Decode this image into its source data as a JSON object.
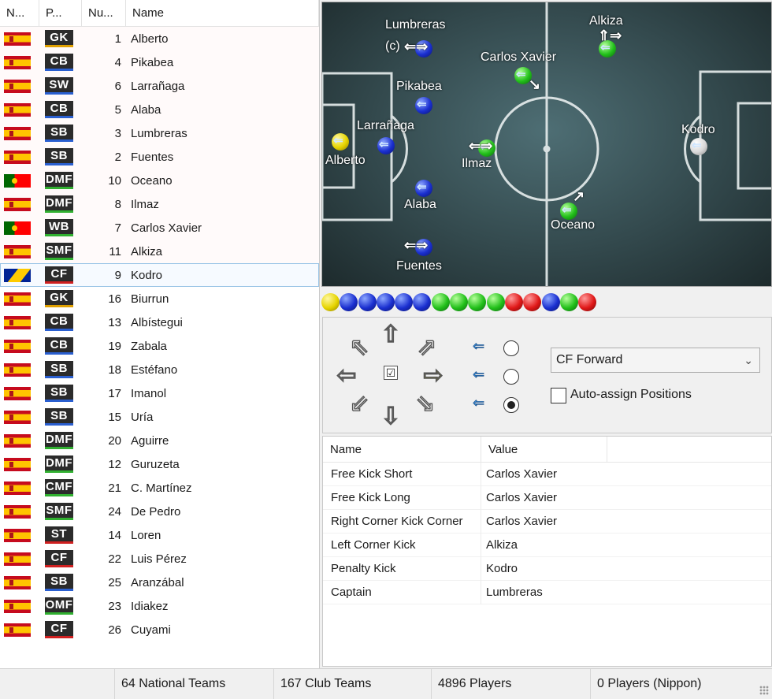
{
  "roster": {
    "headers": {
      "nat": "N...",
      "pos": "P...",
      "num": "Nu...",
      "name": "Name"
    },
    "players": [
      {
        "flag": "es",
        "pos": "GK",
        "cls": "gk",
        "num": "1",
        "name": "Alberto"
      },
      {
        "flag": "es",
        "pos": "CB",
        "cls": "df",
        "num": "4",
        "name": "Pikabea"
      },
      {
        "flag": "es",
        "pos": "SW",
        "cls": "df",
        "num": "6",
        "name": "Larrañaga"
      },
      {
        "flag": "es",
        "pos": "CB",
        "cls": "df",
        "num": "5",
        "name": "Alaba"
      },
      {
        "flag": "es",
        "pos": "SB",
        "cls": "df",
        "num": "3",
        "name": "Lumbreras"
      },
      {
        "flag": "es",
        "pos": "SB",
        "cls": "df",
        "num": "2",
        "name": "Fuentes"
      },
      {
        "flag": "pt",
        "pos": "DMF",
        "cls": "mf",
        "num": "10",
        "name": "Oceano"
      },
      {
        "flag": "es",
        "pos": "DMF",
        "cls": "mf",
        "num": "8",
        "name": "Ilmaz"
      },
      {
        "flag": "pt",
        "pos": "WB",
        "cls": "mf",
        "num": "7",
        "name": "Carlos Xavier"
      },
      {
        "flag": "es",
        "pos": "SMF",
        "cls": "mf",
        "num": "11",
        "name": "Alkiza"
      },
      {
        "flag": "ba",
        "pos": "CF",
        "cls": "fw",
        "num": "9",
        "name": "Kodro"
      },
      {
        "flag": "es",
        "pos": "GK",
        "cls": "gk",
        "num": "16",
        "name": "Biurrun"
      },
      {
        "flag": "es",
        "pos": "CB",
        "cls": "df",
        "num": "13",
        "name": "Albístegui"
      },
      {
        "flag": "es",
        "pos": "CB",
        "cls": "df",
        "num": "19",
        "name": "Zabala"
      },
      {
        "flag": "es",
        "pos": "SB",
        "cls": "df",
        "num": "18",
        "name": "Estéfano"
      },
      {
        "flag": "es",
        "pos": "SB",
        "cls": "df",
        "num": "17",
        "name": "Imanol"
      },
      {
        "flag": "es",
        "pos": "SB",
        "cls": "df",
        "num": "15",
        "name": "Uría"
      },
      {
        "flag": "es",
        "pos": "DMF",
        "cls": "mf",
        "num": "20",
        "name": "Aguirre"
      },
      {
        "flag": "es",
        "pos": "DMF",
        "cls": "mf",
        "num": "12",
        "name": "Guruzeta"
      },
      {
        "flag": "es",
        "pos": "CMF",
        "cls": "mf",
        "num": "21",
        "name": "C. Martínez"
      },
      {
        "flag": "es",
        "pos": "SMF",
        "cls": "mf",
        "num": "24",
        "name": "De Pedro"
      },
      {
        "flag": "es",
        "pos": "ST",
        "cls": "fw",
        "num": "14",
        "name": "Loren"
      },
      {
        "flag": "es",
        "pos": "CF",
        "cls": "fw",
        "num": "22",
        "name": "Luis Pérez"
      },
      {
        "flag": "es",
        "pos": "SB",
        "cls": "df",
        "num": "25",
        "name": "Aranzábal"
      },
      {
        "flag": "es",
        "pos": "OMF",
        "cls": "mf",
        "num": "23",
        "name": "Idiakez"
      },
      {
        "flag": "es",
        "pos": "CF",
        "cls": "fw",
        "num": "26",
        "name": "Cuyami"
      }
    ],
    "starters_count": 11,
    "selected_index": 10
  },
  "pitch": {
    "labels": {
      "alberto": "Alberto",
      "pikabea": "Pikabea",
      "larranaga": "Larrañaga",
      "alaba": "Alaba",
      "lumbreras": "Lumbreras",
      "captain_mark": "(c)",
      "fuentes": "Fuentes",
      "oceano": "Oceano",
      "ilmaz": "Ilmaz",
      "carlos": "Carlos Xavier",
      "alkiza": "Alkiza",
      "kodro": "Kodro"
    }
  },
  "ball_strip": [
    "yellow",
    "blue",
    "blue",
    "blue",
    "blue",
    "blue",
    "green",
    "green",
    "green",
    "green",
    "red",
    "red",
    "blue",
    "green",
    "red"
  ],
  "controls": {
    "position_select": "CF Forward",
    "auto_assign_label": "Auto-assign Positions",
    "auto_assign_checked": false,
    "center_checked": true,
    "active_direction": "right",
    "selected_speed": 3
  },
  "assignments": {
    "headers": {
      "name": "Name",
      "value": "Value"
    },
    "rows": [
      {
        "name": "Free Kick Short",
        "value": "Carlos Xavier"
      },
      {
        "name": "Free Kick Long",
        "value": "Carlos Xavier"
      },
      {
        "name": "Right Corner Kick Corner",
        "value": "Carlos Xavier"
      },
      {
        "name": "Left Corner Kick",
        "value": "Alkiza"
      },
      {
        "name": "Penalty Kick",
        "value": "Kodro"
      },
      {
        "name": "Captain",
        "value": "Lumbreras"
      }
    ]
  },
  "status": {
    "national": "64 National Teams",
    "club": "167 Club Teams",
    "players": "4896 Players",
    "nippon": "0 Players (Nippon)"
  }
}
